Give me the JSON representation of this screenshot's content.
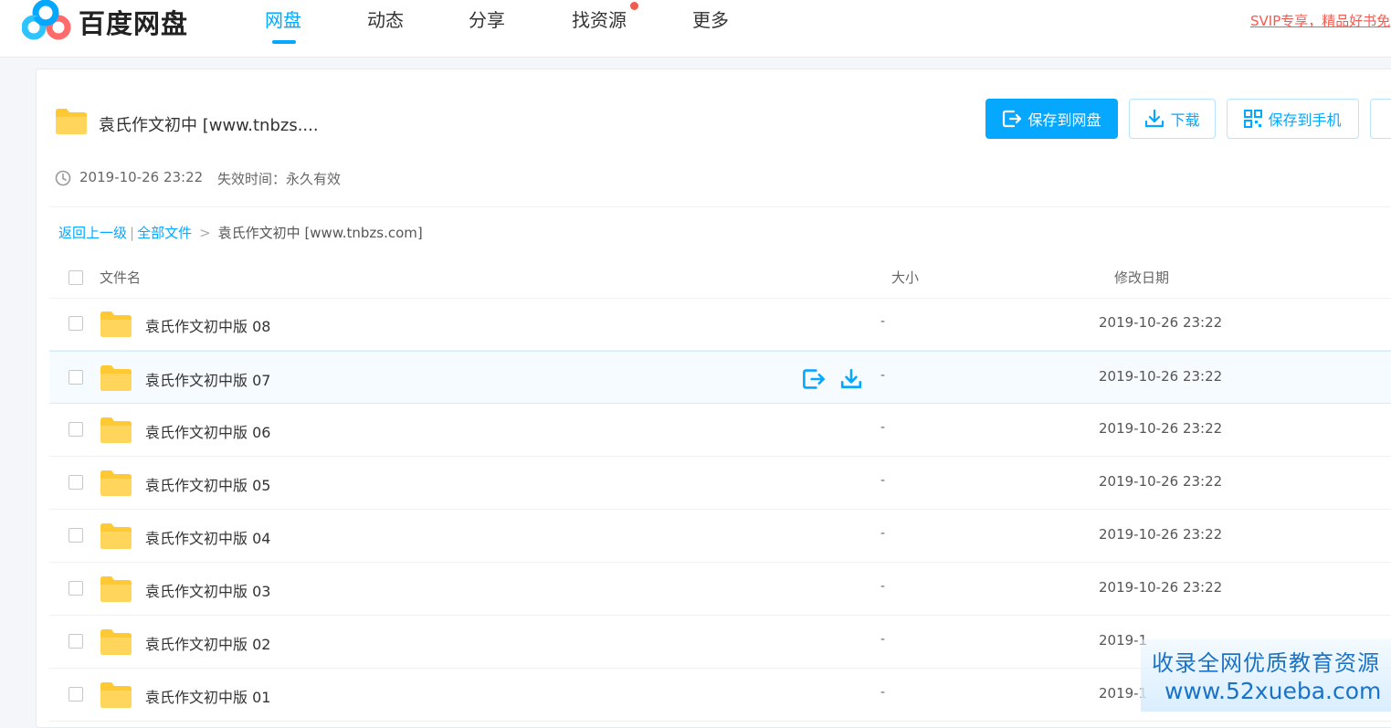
{
  "app": {
    "logo_text": "百度网盘",
    "nav": [
      {
        "label": "网盘",
        "active": true
      },
      {
        "label": "动态",
        "active": false
      },
      {
        "label": "分享",
        "active": false
      },
      {
        "label": "找资源",
        "active": false,
        "has_badge": true
      },
      {
        "label": "更多",
        "active": false
      }
    ],
    "promo_link": "SVIP专享，精品好书免"
  },
  "share": {
    "title": "袁氏作文初中  [www.tnbzs....",
    "created": "2019-10-26 23:22",
    "expire": "失效时间：永久有效",
    "actions": {
      "save_to_disk": "保存到网盘",
      "download": "下载",
      "save_to_phone": "保存到手机"
    }
  },
  "breadcrumb": {
    "back": "返回上一级",
    "divider": "|",
    "all_files": "全部文件",
    "separator": ">",
    "current": "袁氏作文初中 [www.tnbzs.com]"
  },
  "list": {
    "columns": {
      "name": "文件名",
      "size": "大小",
      "modified": "修改日期"
    },
    "rows": [
      {
        "name": "袁氏作文初中版 08",
        "size": "-",
        "modified": "2019-10-26 23:22"
      },
      {
        "name": "袁氏作文初中版 07",
        "size": "-",
        "modified": "2019-10-26 23:22"
      },
      {
        "name": "袁氏作文初中版 06",
        "size": "-",
        "modified": "2019-10-26 23:22"
      },
      {
        "name": "袁氏作文初中版 05",
        "size": "-",
        "modified": "2019-10-26 23:22"
      },
      {
        "name": "袁氏作文初中版 04",
        "size": "-",
        "modified": "2019-10-26 23:22"
      },
      {
        "name": "袁氏作文初中版 03",
        "size": "-",
        "modified": "2019-10-26 23:22"
      },
      {
        "name": "袁氏作文初中版 02",
        "size": "-",
        "modified": "2019-1"
      },
      {
        "name": "袁氏作文初中版 01",
        "size": "-",
        "modified": "2019-1"
      }
    ]
  },
  "watermark": {
    "line1": "收录全网优质教育资源",
    "line2": "www.52xueba.com"
  },
  "colors": {
    "accent": "#06a7ff",
    "badge": "#f25a4f",
    "folder": "#ffd55c"
  },
  "icons": {
    "logo": "cloud-logo-icon",
    "folder": "folder-icon",
    "clock": "clock-icon",
    "save": "save-to-disk-icon",
    "download": "download-icon",
    "phone": "qr-phone-icon"
  }
}
